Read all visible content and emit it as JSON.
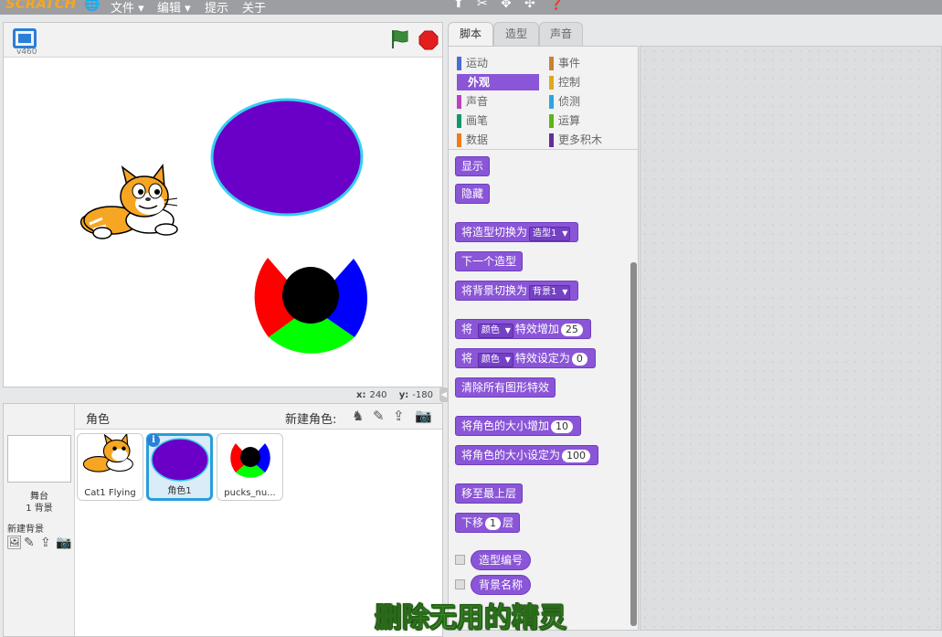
{
  "menubar": {
    "logo": "SCRATCH",
    "file": "文件 ▾",
    "edit": "编辑 ▾",
    "tips": "提示",
    "about": "关于"
  },
  "stage": {
    "version": "v460",
    "mouse_x_label": "x:",
    "mouse_x": "240",
    "mouse_y_label": "y:",
    "mouse_y": "-180"
  },
  "sprites_panel": {
    "title": "角色",
    "new_sprite_label": "新建角色:",
    "stage_label": "舞台",
    "stage_backdrop_count": "1 背景",
    "new_backdrop_label": "新建背景",
    "sprites": [
      {
        "name": "Cat1 Flying",
        "selected": false
      },
      {
        "name": "角色1",
        "selected": true
      },
      {
        "name": "pucks_nu...",
        "selected": false
      }
    ]
  },
  "tabs": [
    {
      "label": "脚本",
      "active": true
    },
    {
      "label": "造型",
      "active": false
    },
    {
      "label": "声音",
      "active": false
    }
  ],
  "categories": [
    {
      "label": "运动",
      "color": "#4a6cd4",
      "selected": false
    },
    {
      "label": "事件",
      "color": "#c88330",
      "selected": false
    },
    {
      "label": "外观",
      "color": "#8a55d7",
      "selected": true
    },
    {
      "label": "控制",
      "color": "#e1a91a",
      "selected": false
    },
    {
      "label": "声音",
      "color": "#bb42c3",
      "selected": false
    },
    {
      "label": "侦测",
      "color": "#2ca5e2",
      "selected": false
    },
    {
      "label": "画笔",
      "color": "#0e9a6c",
      "selected": false
    },
    {
      "label": "运算",
      "color": "#5cb712",
      "selected": false
    },
    {
      "label": "数据",
      "color": "#ee7d16",
      "selected": false
    },
    {
      "label": "更多积木",
      "color": "#632d99",
      "selected": false
    }
  ],
  "blocks": {
    "show": "显示",
    "hide": "隐藏",
    "switch_costume_prefix": "将造型切换为",
    "switch_costume_value": "造型1",
    "next_costume": "下一个造型",
    "switch_backdrop_prefix": "将背景切换为",
    "switch_backdrop_value": "背景1",
    "change_effect_prefix": "将",
    "change_effect_dd": "颜色",
    "change_effect_suffix": "特效增加",
    "change_effect_value": "25",
    "set_effect_prefix": "将",
    "set_effect_dd": "颜色",
    "set_effect_suffix": "特效设定为",
    "set_effect_value": "0",
    "clear_effects": "清除所有图形特效",
    "change_size_prefix": "将角色的大小增加",
    "change_size_value": "10",
    "set_size_prefix": "将角色的大小设定为",
    "set_size_value": "100",
    "go_front": "移至最上层",
    "go_back_prefix": "下移",
    "go_back_value": "1",
    "go_back_suffix": "层",
    "costume_number": "造型编号",
    "backdrop_name": "背景名称"
  },
  "caption": "删除无用的精灵",
  "colors": {
    "looks": "#8a55d7",
    "ellipse_fill": "#6a00c8",
    "ellipse_outline": "#34d0f0",
    "puck_red": "#ff0000",
    "puck_blue": "#0000ff",
    "puck_green": "#00ff00",
    "puck_center": "#000000",
    "selection": "#2a9ed8"
  }
}
